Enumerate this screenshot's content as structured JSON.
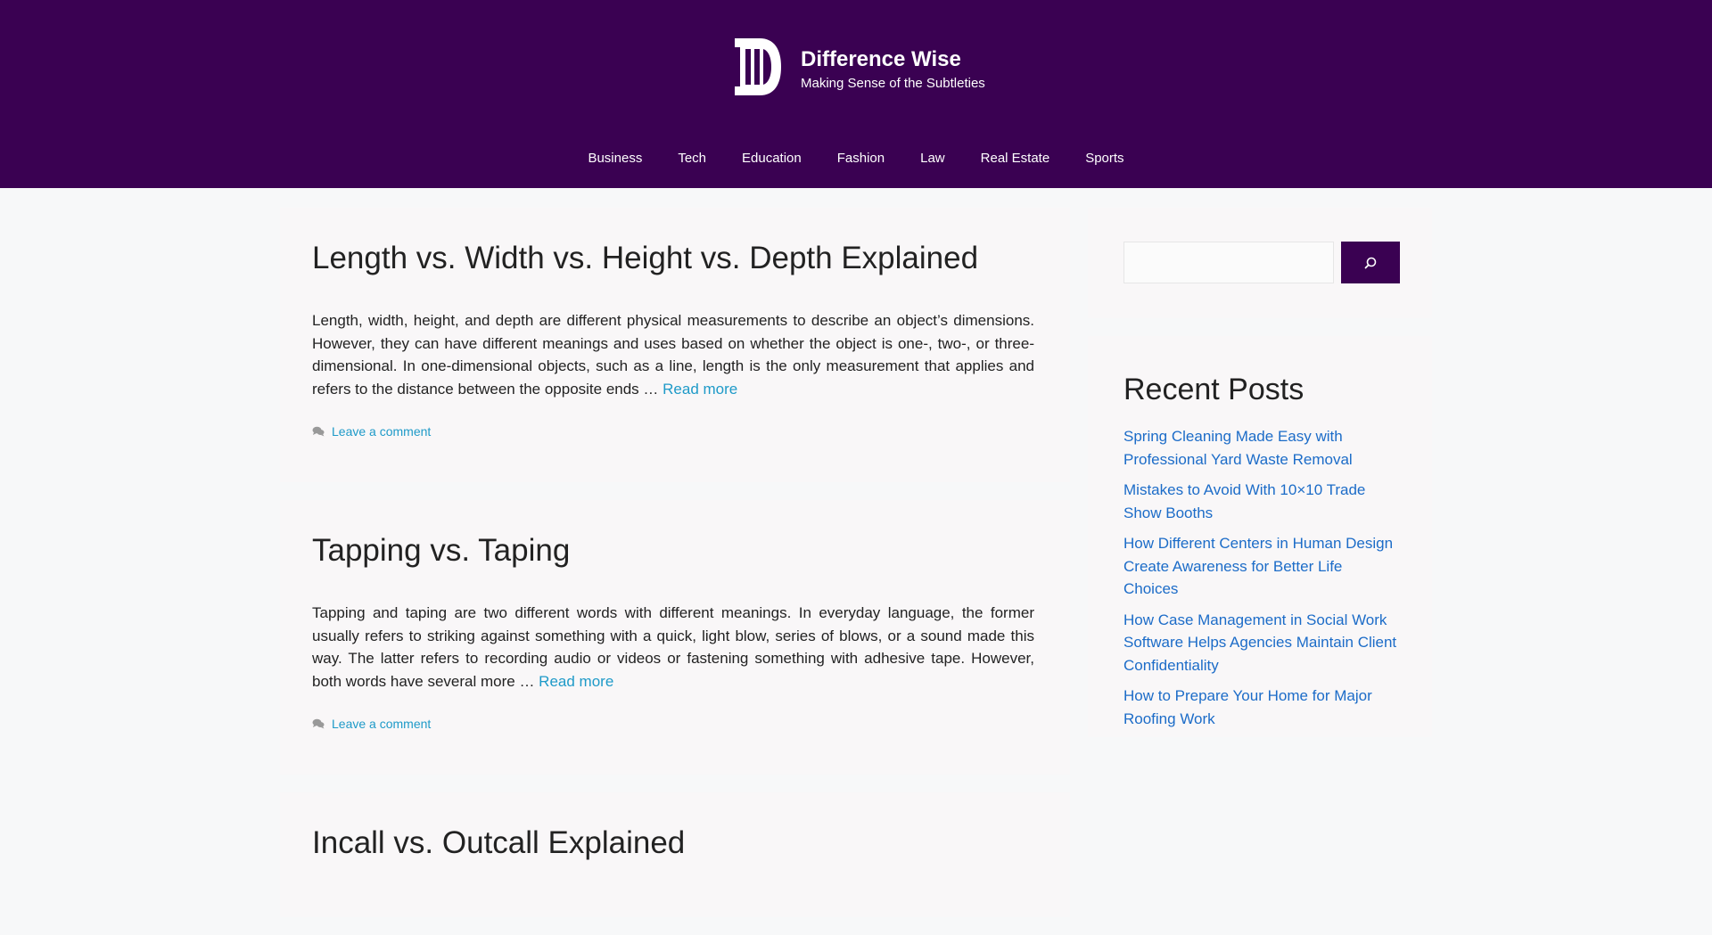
{
  "site": {
    "title": "Difference Wise",
    "tagline": "Making Sense of the Subtleties",
    "header_color": "#3a0152",
    "logo_icon": "stylized-d-logo-icon"
  },
  "nav": {
    "items": [
      "Business",
      "Tech",
      "Education",
      "Fashion",
      "Law",
      "Real Estate",
      "Sports"
    ]
  },
  "posts": [
    {
      "title": "Length vs. Width vs. Height vs. Depth Explained",
      "excerpt": "Length, width, height, and depth are different physical measurements to describe an object’s dimensions. However, they can have different meanings and uses based on whether the object is one-, two-, or three-dimensional. In one-dimensional objects, such as a line, length is the only measurement that applies and refers to the distance between the opposite ends … ",
      "read_more": "Read more",
      "comment_link": "Leave a comment"
    },
    {
      "title": "Tapping vs. Taping",
      "excerpt": "Tapping and taping are two different words with different meanings. In everyday language, the former usually refers to striking against something with a quick, light blow, series of blows, or a sound made this way. The latter refers to recording audio or videos or fastening something with adhesive tape. However, both words have several more … ",
      "read_more": "Read more",
      "comment_link": "Leave a comment"
    },
    {
      "title": "Incall vs. Outcall Explained"
    }
  ],
  "sidebar": {
    "search": {
      "placeholder": "",
      "button_icon": "search-icon"
    },
    "recent_posts": {
      "heading": "Recent Posts",
      "items": [
        "Spring Cleaning Made Easy with Professional Yard Waste Removal",
        "Mistakes to Avoid With 10×10 Trade Show Booths",
        "How Different Centers in Human Design Create Awareness for Better Life Choices",
        "How Case Management in Social Work Software Helps Agencies Maintain Client Confidentiality",
        "How to Prepare Your Home for Major Roofing Work"
      ]
    }
  }
}
